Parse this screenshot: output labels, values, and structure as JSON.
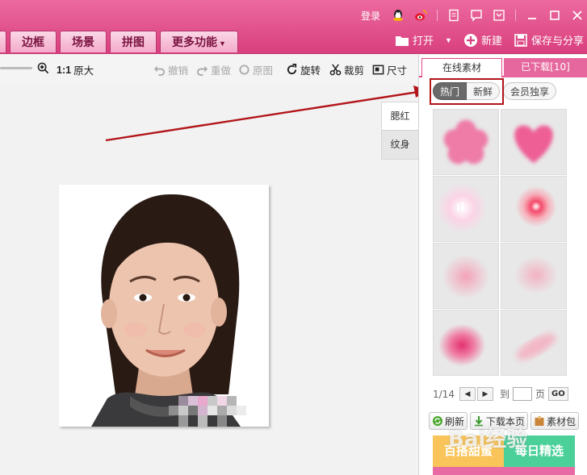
{
  "titlebar": {
    "login": "登录",
    "icons": [
      "qq-icon",
      "weibo-icon",
      "document-icon",
      "message-icon",
      "dropdown-icon",
      "minimize-icon",
      "maximize-icon",
      "close-icon"
    ]
  },
  "menu_tabs": [
    {
      "label": "边框"
    },
    {
      "label": "场景"
    },
    {
      "label": "拼图"
    },
    {
      "label": "更多功能"
    }
  ],
  "file_actions": {
    "open": "打开",
    "new": "新建",
    "save_share": "保存与分享"
  },
  "edit_toolbar": {
    "zoom_ratio": "1:1",
    "original_size": "原大",
    "undo": "撤销",
    "redo": "重做",
    "original": "原图",
    "rotate": "旋转",
    "crop": "裁剪",
    "size": "尺寸"
  },
  "side_tabs": [
    "腮红",
    "纹身"
  ],
  "panel": {
    "tab_online": "在线素材",
    "tab_downloaded": "已下载[10]",
    "filter_hot": "热门",
    "filter_new": "新鲜",
    "filter_member": "会员独享",
    "page_current": "1/14",
    "page_to": "到",
    "page_unit": "页",
    "go": "GO",
    "refresh": "刷新",
    "download_page": "下载本页",
    "material_pack": "素材包",
    "banner_left": "百搭甜蜜",
    "banner_right": "每日精选"
  },
  "watermark": "Bai经验",
  "colors": {
    "brand_pink": "#e64887",
    "highlight_red": "#b2151a"
  }
}
